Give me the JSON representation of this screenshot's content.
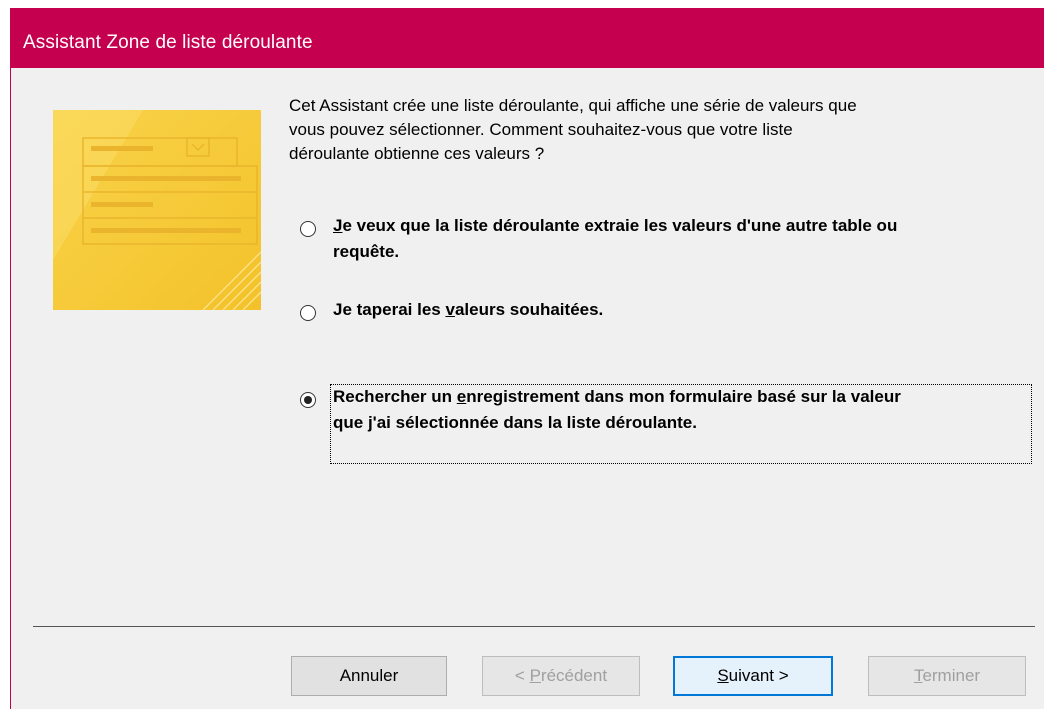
{
  "window": {
    "title": "Assistant Zone de liste déroulante"
  },
  "intro": {
    "lines": [
      "Cet Assistant crée une liste déroulante, qui affiche une série de valeurs que",
      "vous pouvez sélectionner. Comment souhaitez-vous que votre liste",
      "déroulante obtienne ces valeurs ?"
    ]
  },
  "options": [
    {
      "mnemonic": "J",
      "line1_rest": "e veux que la liste déroulante extraie les valeurs d'une autre table ou",
      "line2": "requête.",
      "selected": false
    },
    {
      "pre": "Je taperai les ",
      "mnemonic": "v",
      "post": "aleurs souhaitées.",
      "selected": false
    },
    {
      "pre": "Rechercher un ",
      "mnemonic": "e",
      "post": "nregistrement dans mon formulaire basé sur la valeur",
      "line2": "que j'ai sélectionnée dans la liste déroulante.",
      "selected": true
    }
  ],
  "buttons": {
    "cancel": {
      "label": "Annuler",
      "enabled": true
    },
    "previous": {
      "pre": "< ",
      "mnemonic": "P",
      "post": "récédent",
      "enabled": false
    },
    "next": {
      "mnemonic": "S",
      "post": "uivant >",
      "enabled": true,
      "default": true
    },
    "finish": {
      "mnemonic": "T",
      "post": "erminer",
      "enabled": false
    }
  },
  "colors": {
    "title_bar": "#c4004f",
    "illustration": "#f6cc3b"
  }
}
